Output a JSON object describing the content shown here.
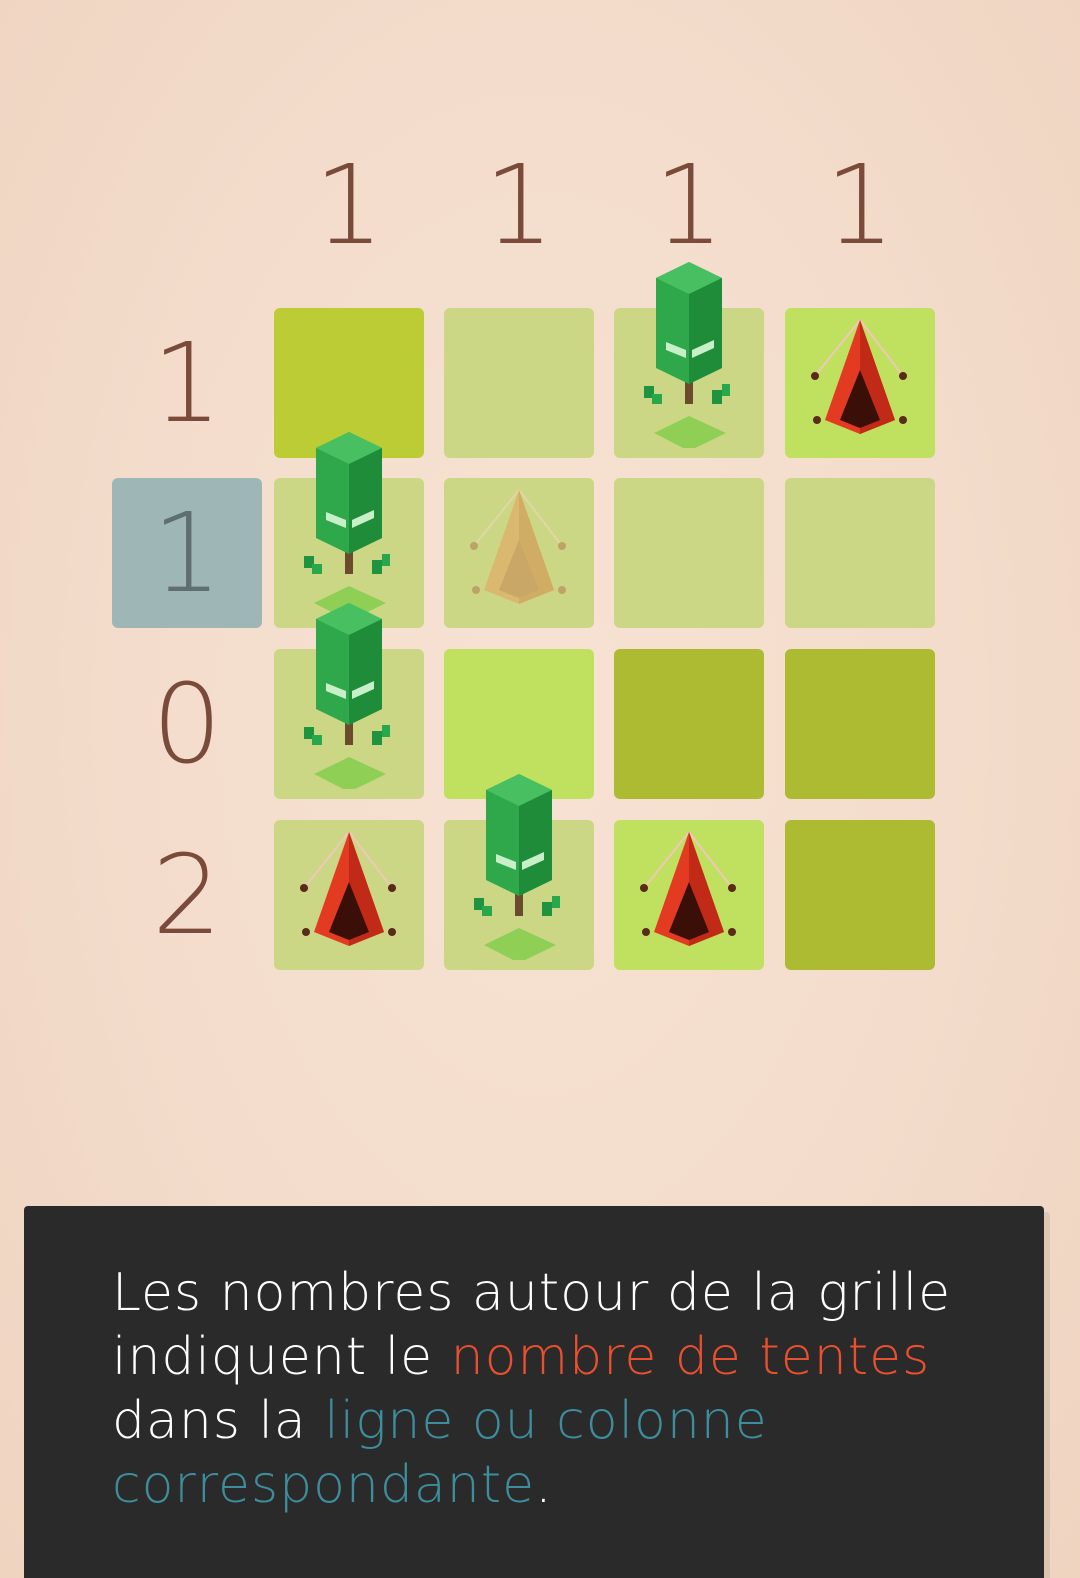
{
  "column_clues": [
    "1",
    "1",
    "1",
    "1"
  ],
  "row_clues": [
    "1",
    "1",
    "0",
    "2"
  ],
  "active_row": 1,
  "grid": [
    [
      "lime-grass",
      "empty",
      "tree",
      "tent"
    ],
    [
      "tree",
      "tent-hint",
      "empty",
      "empty"
    ],
    [
      "tree",
      "bright-grass",
      "grass",
      "grass"
    ],
    [
      "tent",
      "tree",
      "tent",
      "grass"
    ]
  ],
  "colors": {
    "background": "#f3dccb",
    "clue_text": "#7a4b3a",
    "active_clue_bg": "#9fb6b6",
    "panel_bg": "#2a2a2a",
    "highlight_red": "#e8502f",
    "highlight_teal": "#3d8d9d"
  },
  "tutorial": {
    "part1": "Les nombres autour de la grille indiquent le ",
    "highlight1": "nombre de tentes",
    "part2": " dans la ",
    "highlight2": "ligne ou colonne correspondante",
    "part3": "."
  }
}
